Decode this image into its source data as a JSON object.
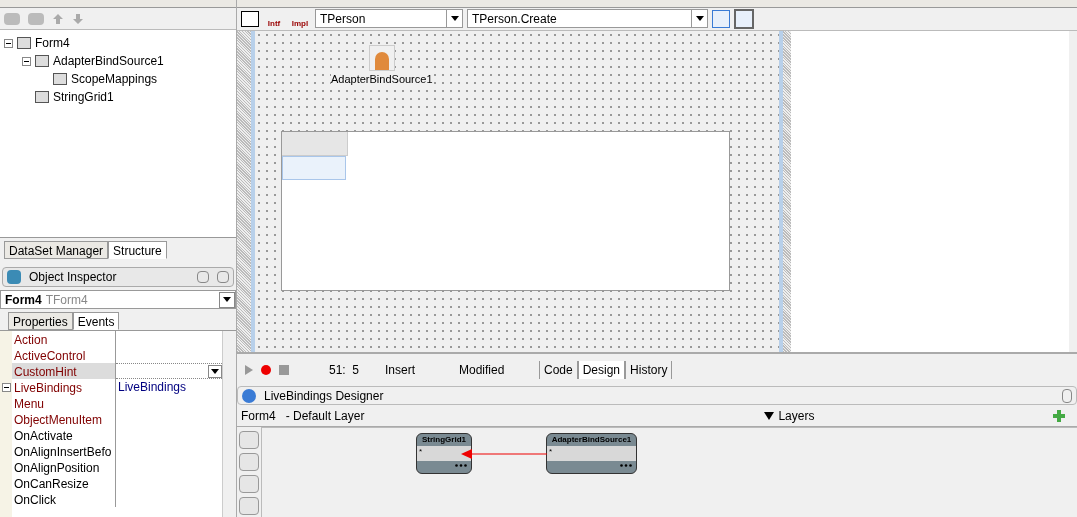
{
  "structure_tree": [
    {
      "label": "Form4",
      "expanded": true,
      "children": [
        {
          "label": "AdapterBindSource1",
          "expanded": true,
          "children": [
            {
              "label": "ScopeMappings"
            }
          ]
        },
        {
          "label": "StringGrid1"
        }
      ]
    }
  ],
  "left_tabs": [
    {
      "label": "DataSet Manager",
      "selected": false
    },
    {
      "label": "Structure",
      "selected": true
    }
  ],
  "object_inspector": {
    "title": "Object Inspector",
    "object_name": "Form4",
    "object_type": "TForm4",
    "tabs": [
      {
        "label": "Properties",
        "selected": false
      },
      {
        "label": "Events",
        "selected": true
      }
    ],
    "rows": [
      {
        "name": "Action",
        "kind": "reference",
        "selected": false
      },
      {
        "name": "ActiveControl",
        "kind": "reference",
        "selected": false
      },
      {
        "name": "CustomHint",
        "kind": "reference",
        "selected": true
      },
      {
        "name": "LiveBindings",
        "kind": "reference",
        "selected": false,
        "expanded": true,
        "value": "LiveBindings"
      },
      {
        "name": "Menu",
        "kind": "reference",
        "selected": false
      },
      {
        "name": "ObjectMenuItem",
        "kind": "reference",
        "selected": false
      },
      {
        "name": "OnActivate",
        "kind": "event",
        "selected": false
      },
      {
        "name": "OnAlignInsertBefo",
        "kind": "event",
        "selected": false
      },
      {
        "name": "OnAlignPosition",
        "kind": "event",
        "selected": false
      },
      {
        "name": "OnCanResize",
        "kind": "event",
        "selected": false
      },
      {
        "name": "OnClick",
        "kind": "event",
        "selected": false
      }
    ]
  },
  "editor_toolbar": {
    "buttons": [
      "Intf",
      "Impl"
    ],
    "class_combo": "TPerson",
    "method_combo": "TPerson.Create"
  },
  "form_designer": {
    "component_label": "AdapterBindSource1"
  },
  "status_bar": {
    "position": "51:  5",
    "mode": "Insert",
    "state": "Modified"
  },
  "view_tabs": [
    {
      "label": "Code",
      "selected": false
    },
    {
      "label": "Design",
      "selected": true
    },
    {
      "label": "History",
      "selected": false
    }
  ],
  "livebindings": {
    "title": "LiveBindings Designer",
    "layer": "Form4   - Default Layer",
    "layers_button": "Layers",
    "nodes": [
      {
        "title": "StringGrid1",
        "field": "*"
      },
      {
        "title": "AdapterBindSource1",
        "field": "*"
      }
    ]
  }
}
